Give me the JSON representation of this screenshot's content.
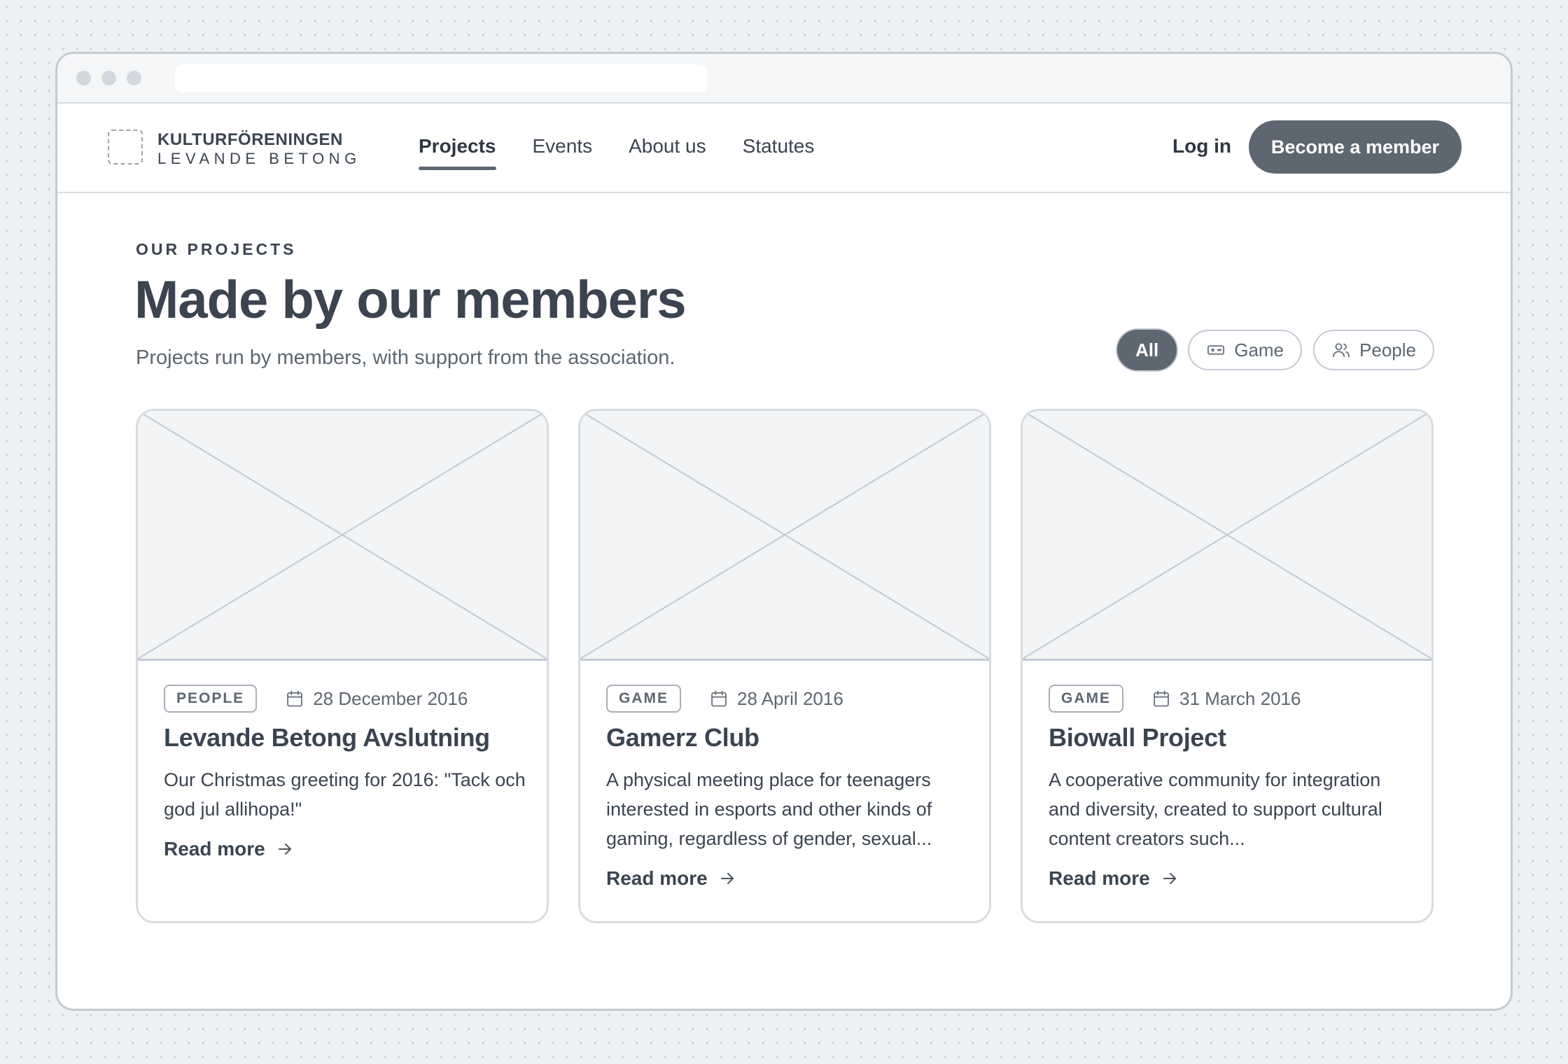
{
  "brand": {
    "line1": "KULTURFÖRENINGEN",
    "line2": "LEVANDE BETONG"
  },
  "nav": {
    "links": [
      {
        "label": "Projects",
        "active": true
      },
      {
        "label": "Events",
        "active": false
      },
      {
        "label": "About us",
        "active": false
      },
      {
        "label": "Statutes",
        "active": false
      }
    ],
    "login_label": "Log in",
    "cta_label": "Become a member"
  },
  "hero": {
    "eyebrow": "OUR PROJECTS",
    "title": "Made by our members",
    "subtitle": "Projects run by members, with support from the association."
  },
  "filters": [
    {
      "label": "All",
      "active": true,
      "icon": ""
    },
    {
      "label": "Game",
      "active": false,
      "icon": "gamepad-icon"
    },
    {
      "label": "People",
      "active": false,
      "icon": "people-icon"
    }
  ],
  "cards": [
    {
      "tag": "PEOPLE",
      "date": "28 December 2016",
      "title": "Levande Betong Avslutning",
      "description": "Our Christmas greeting for 2016: \"Tack och god jul allihopa!\"",
      "link_label": "Read more"
    },
    {
      "tag": "GAME",
      "date": "28 April 2016",
      "title": "Gamerz Club",
      "description": "A physical meeting place for teenagers interested in esports and other kinds of gaming, regardless of gender, sexual...",
      "link_label": "Read more"
    },
    {
      "tag": "GAME",
      "date": "31 March 2016",
      "title": "Biowall Project",
      "description": "A cooperative community for integration and diversity, created to support cultural content creators such...",
      "link_label": "Read more"
    }
  ],
  "colors": {
    "accent": "#5d6771",
    "text": "#3b4450",
    "border": "#c4cad3",
    "placeholder_fill": "#f2f4f6"
  }
}
